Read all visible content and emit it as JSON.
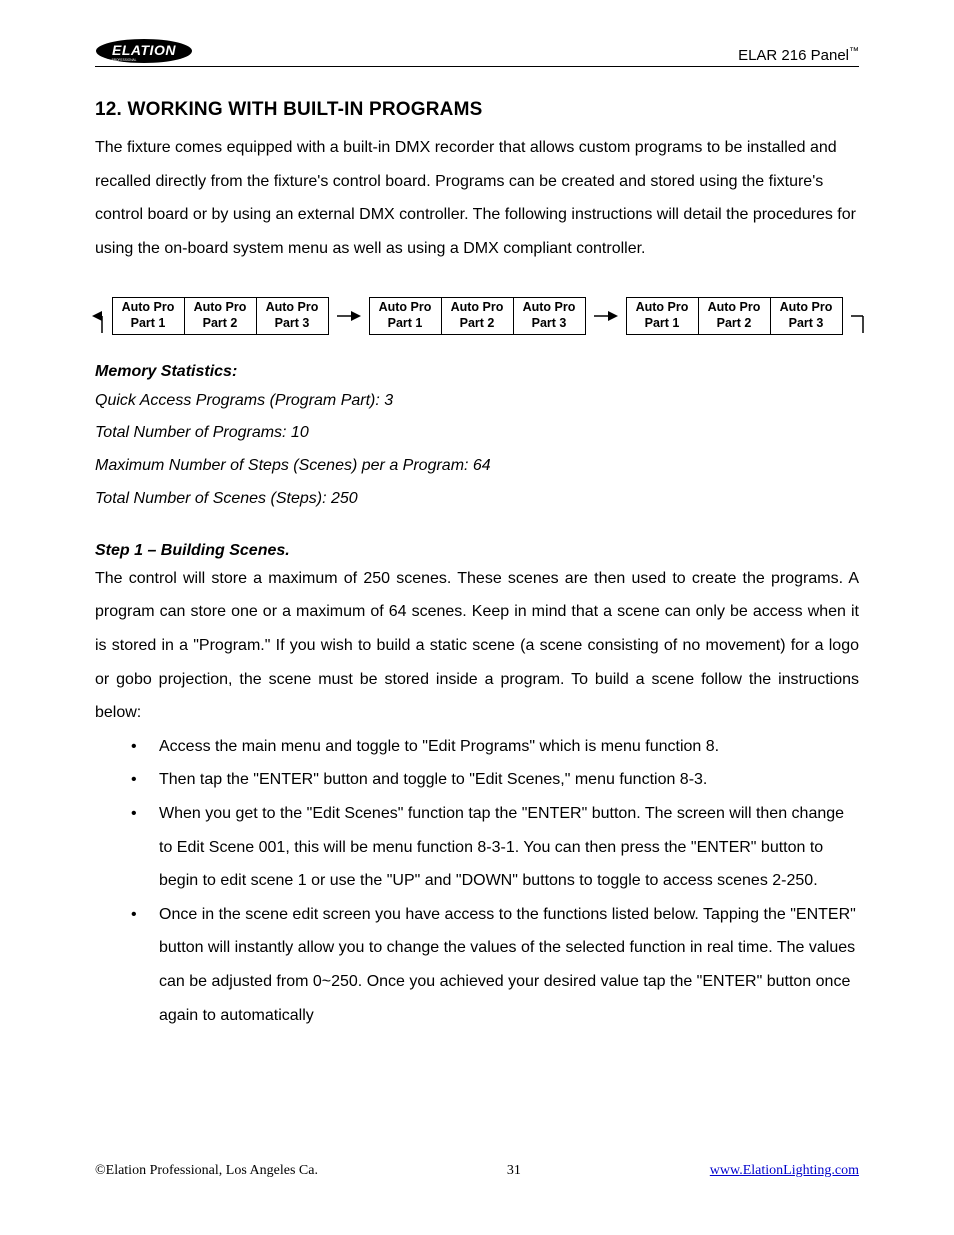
{
  "header": {
    "brand": "ELATION",
    "brand_sub": "PROFESSIONAL",
    "product": "ELAR 216 Panel",
    "trademark": "™"
  },
  "section": {
    "title": "12. WORKING WITH BUILT-IN PROGRAMS",
    "intro": "The fixture comes equipped with a built-in DMX recorder that allows custom programs to be installed and recalled directly from the fixture's control board. Programs can be created and stored using the fixture's control board or by using an external DMX controller. The following instructions will detail the procedures for using the on-board system menu as well as using a DMX compliant controller."
  },
  "diagram": {
    "groups": [
      [
        "Auto Pro Part 1",
        "Auto Pro Part 2",
        "Auto Pro Part 3"
      ],
      [
        "Auto Pro Part 1",
        "Auto Pro Part 2",
        "Auto Pro Part 3"
      ],
      [
        "Auto Pro Part 1",
        "Auto Pro Part 2",
        "Auto Pro Part 3"
      ]
    ]
  },
  "memory": {
    "heading": "Memory Statistics:",
    "lines": [
      "Quick Access Programs (Program Part): 3",
      "Total Number of Programs: 10",
      "Maximum Number of Steps (Scenes) per a Program: 64",
      "Total Number of Scenes (Steps): 250"
    ]
  },
  "step1": {
    "heading": "Step 1 – Building Scenes.",
    "body": "The control will store a maximum of 250 scenes. These scenes are then used to create the programs. A program can store one or a maximum of 64 scenes. Keep in mind that a scene can only be access when it is stored in a \"Program.\" If you wish to build a static scene (a scene consisting of no movement) for a logo or gobo projection, the scene must be stored inside a program. To build a scene follow the instructions below:",
    "bullets": [
      "Access the main menu and toggle to \"Edit Programs\" which is menu function 8.",
      "Then tap the \"ENTER\" button and toggle to \"Edit Scenes,\" menu function 8-3.",
      "When you get to the \"Edit Scenes\" function tap the \"ENTER\" button. The screen will then change to Edit Scene 001, this will be menu function 8-3-1. You can then press the \"ENTER\" button to begin to edit scene 1 or use the \"UP\" and \"DOWN\" buttons to toggle to access scenes 2-250.",
      "Once in the scene edit screen you have access to the functions listed below. Tapping the \"ENTER\" button will instantly allow you to change the values of the selected function in real time. The values can be adjusted from 0~250. Once you achieved your desired value tap the \"ENTER\" button once again to automatically"
    ]
  },
  "footer": {
    "copyright": "©Elation Professional, Los Angeles Ca.",
    "page": "31",
    "link": "www.ElationLighting.com"
  }
}
